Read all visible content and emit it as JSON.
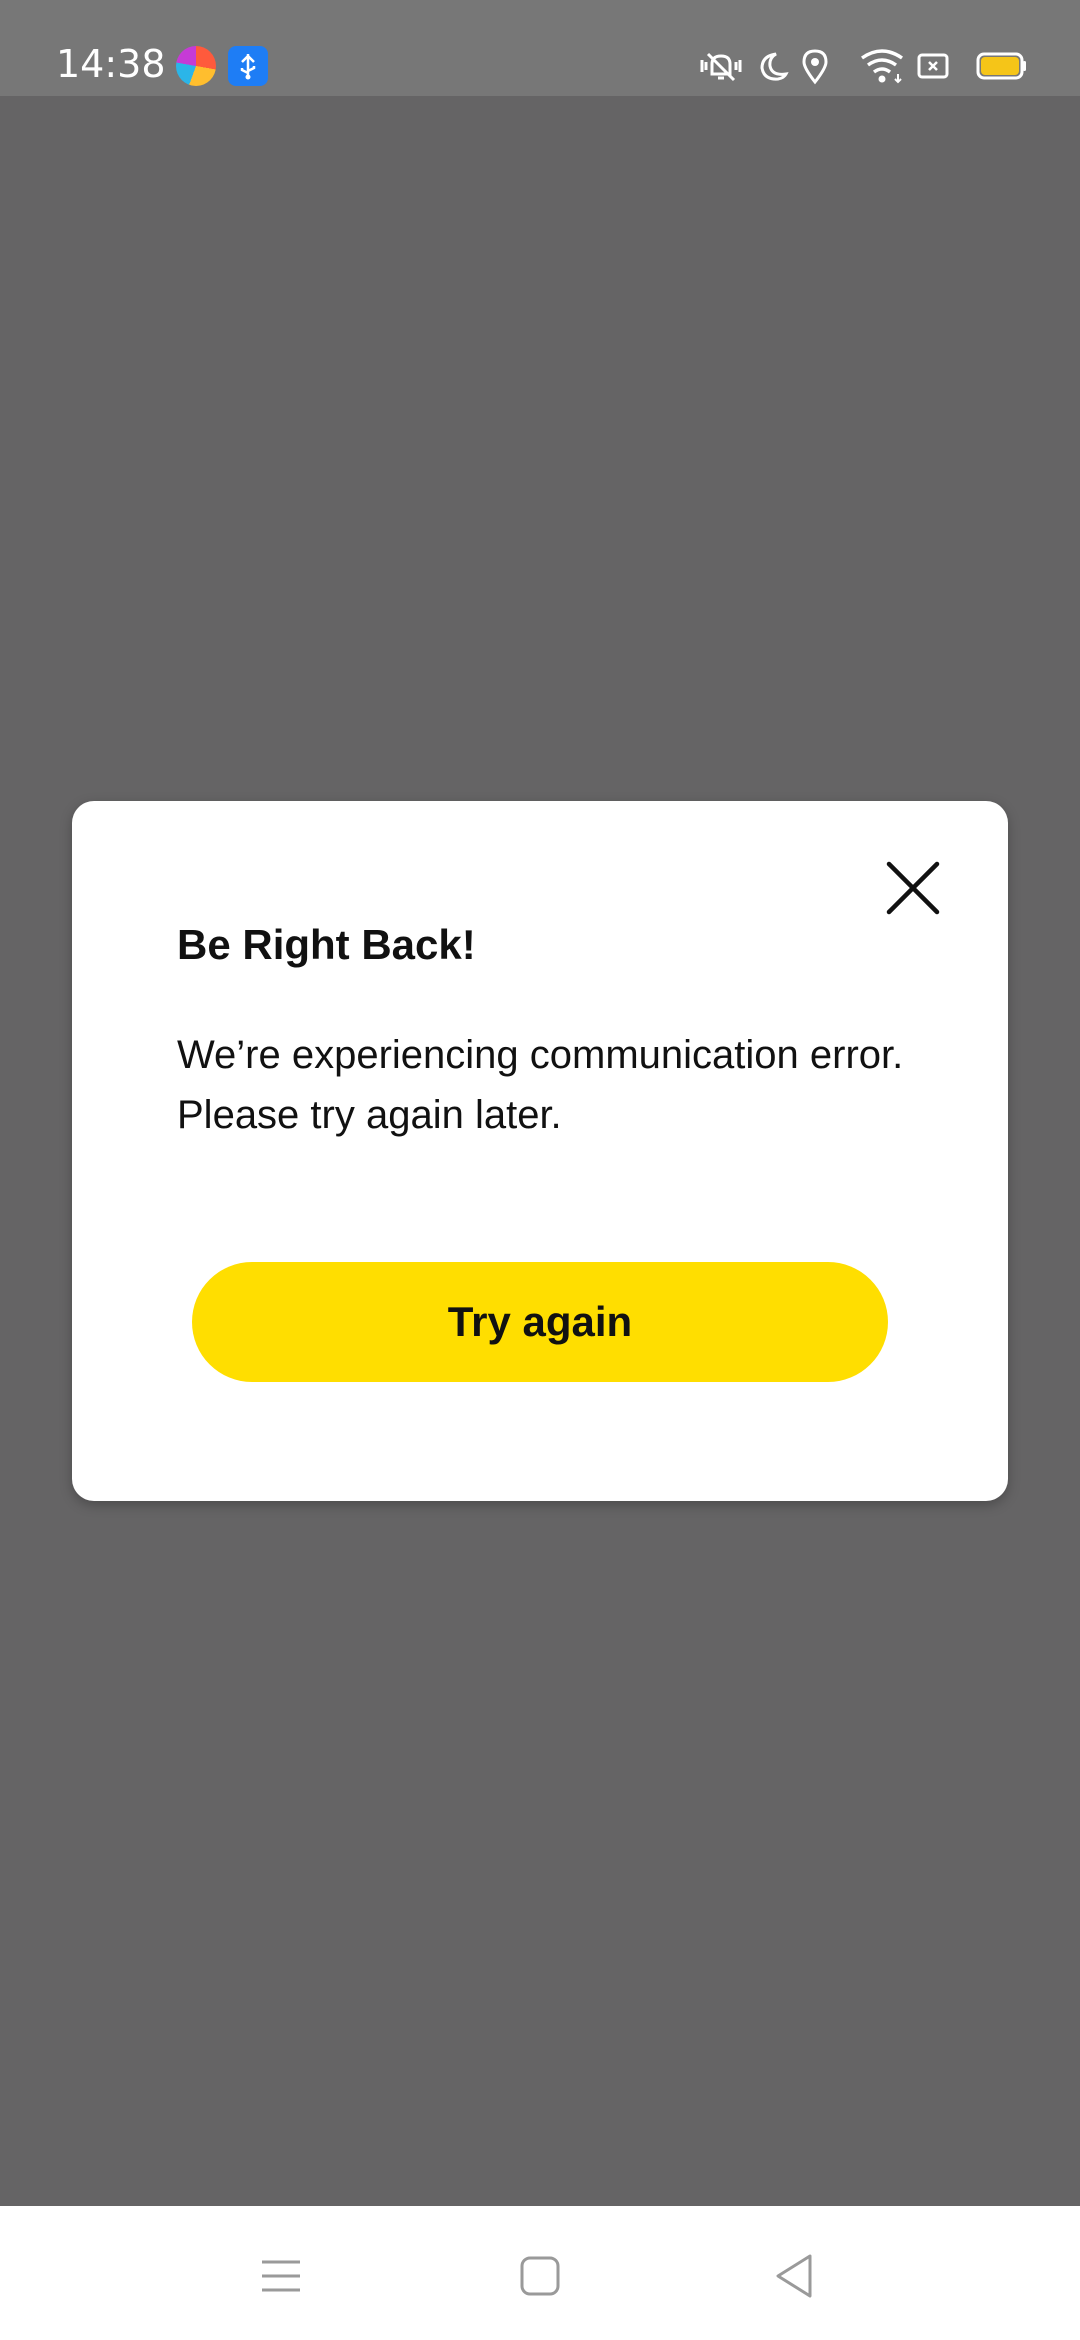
{
  "status_bar": {
    "time": "14:38",
    "icons": [
      "browser-app-icon",
      "usb-debug-icon",
      "vibrate-mute-icon",
      "do-not-disturb-icon",
      "location-icon",
      "wifi-icon",
      "sim-card-icon",
      "battery-icon"
    ]
  },
  "dialog": {
    "title": "Be Right Back!",
    "message": "We’re experiencing communication error. Please try again later.",
    "primary_button": "Try again",
    "close_icon": "close-icon"
  },
  "nav_bar": {
    "icons": [
      "menu-icon",
      "home-icon",
      "back-icon"
    ]
  },
  "colors": {
    "accent": "#ffde00",
    "overlay": "#656465",
    "status_bar": "#777777",
    "battery": "#f5c518"
  }
}
